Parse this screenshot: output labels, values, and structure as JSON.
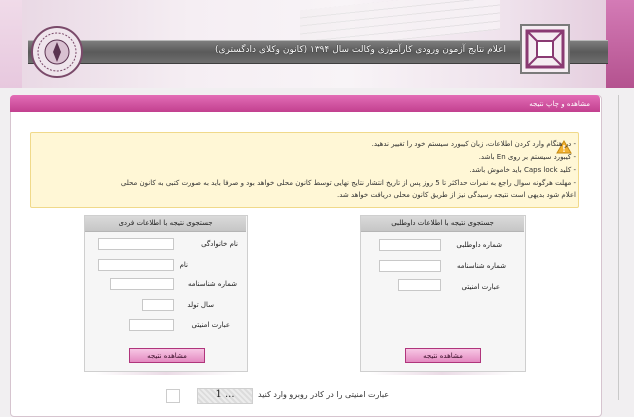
{
  "header": {
    "title": "اعلام نتایج آزمون ورودی کارآموزی وکالت سال ۱۳۹۴ (کانون وکلای دادگستری)"
  },
  "panel": {
    "title": "مشاهده و چاپ نتیجه"
  },
  "notice": {
    "lines": [
      "- در هنگام وارد کردن اطلاعات، زبان کیبورد سیستم خود را تغییر ندهید.",
      "- کیبورد سیستم بر روی En باشد.",
      "- کلید Caps lock باید خاموش باشد.",
      "- مهلت هرگونه سوال راجع به نمرات حداکثر تا 5 روز پس از تاریخ انتشار نتایج نهایی توسط کانون محلی خواهد بود و صرفا باید به صورت کتبی به کانون محلی",
      "اعلام شود بدیهی است نتیجه رسیدگی نیز از طریق کانون محلی دریافت خواهد شد."
    ]
  },
  "personal_search": {
    "header": "جستجوی نتیجه با اطلاعات فردی",
    "fields": {
      "last_name": "نام خانوادگی",
      "first_name": "نام",
      "id_number": "شماره شناسنامه",
      "birth_year": "سال تولد",
      "security_phrase": "عبارت امنیتی"
    },
    "button": "مشاهده نتیجه"
  },
  "applicant_search": {
    "header": "جستجوی نتیجه با اطلاعات داوطلبی",
    "fields": {
      "applicant_number": "شماره داوطلبی",
      "id_number": "شماره شناسنامه",
      "security_phrase": "عبارت امنیتی"
    },
    "button": "مشاهده نتیجه"
  },
  "captcha": {
    "image_text": "1 ...",
    "instruction": "عبارت امنیتی را در کادر روبرو وارد کنید"
  }
}
